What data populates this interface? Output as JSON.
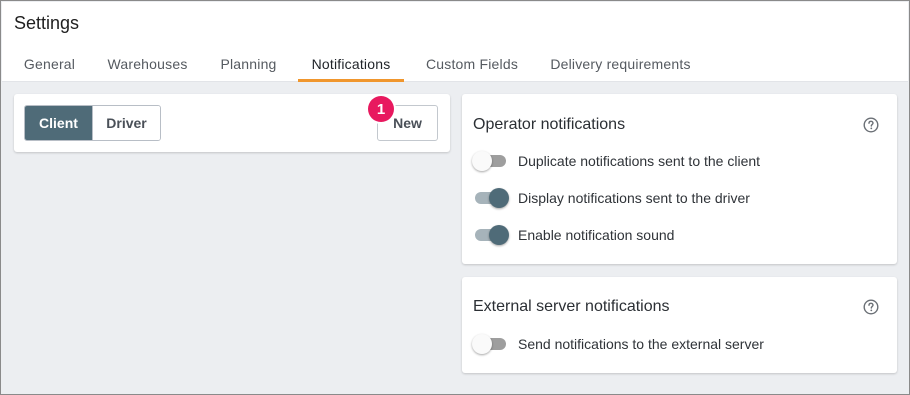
{
  "page": {
    "title": "Settings"
  },
  "tabs": [
    {
      "label": "General"
    },
    {
      "label": "Warehouses"
    },
    {
      "label": "Planning"
    },
    {
      "label": "Notifications",
      "active": true
    },
    {
      "label": "Custom Fields"
    },
    {
      "label": "Delivery requirements"
    }
  ],
  "left_panel": {
    "segment": {
      "client_label": "Client",
      "driver_label": "Driver",
      "selected": "Client"
    },
    "new_label": "New",
    "step_badge": "1"
  },
  "operator": {
    "title": "Operator notifications",
    "items": [
      {
        "label": "Duplicate notifications sent to the client",
        "enabled": false
      },
      {
        "label": "Display notifications sent to the driver",
        "enabled": true
      },
      {
        "label": "Enable notification sound",
        "enabled": true
      }
    ]
  },
  "external": {
    "title": "External server notifications",
    "items": [
      {
        "label": "Send notifications to the external server",
        "enabled": false
      }
    ]
  },
  "colors": {
    "accent_tab": "#f0962d",
    "selected_segment": "#4f6b78",
    "toggle_on": "#4f6b78",
    "badge": "#e8195f"
  }
}
